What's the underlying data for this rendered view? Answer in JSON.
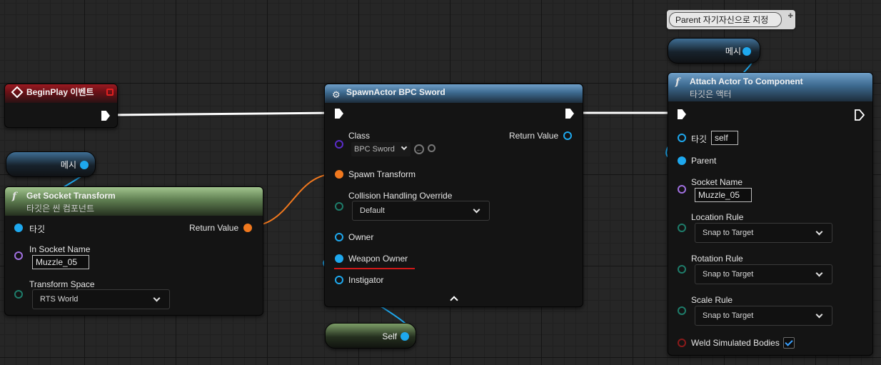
{
  "nodes": {
    "begin_play": {
      "title": "BeginPlay 이벤트"
    },
    "mesh_var_left": {
      "label": "메시"
    },
    "get_socket_transform": {
      "title": "Get Socket Transform",
      "subtitle": "타깃은 씬 컴포넌트",
      "target_label": "타깃",
      "return_label": "Return Value",
      "socket_name_label": "In Socket Name",
      "socket_name_value": "Muzzle_05",
      "transform_space_label": "Transform Space",
      "transform_space_value": "RTS World"
    },
    "spawn_actor": {
      "title": "SpawnActor BPC Sword",
      "class_label": "Class",
      "class_value": "BPC Sword",
      "return_label": "Return Value",
      "spawn_transform_label": "Spawn Transform",
      "collision_label": "Collision Handling Override",
      "collision_value": "Default",
      "owner_label": "Owner",
      "weapon_owner_label": "Weapon Owner",
      "instigator_label": "Instigator",
      "collapse_icon": "chevron-up-icon"
    },
    "self_var": {
      "label": "Self"
    },
    "comment": {
      "text": "Parent 자기자신으로 지정"
    },
    "mesh_var_right": {
      "label": "메시"
    },
    "attach_actor": {
      "title": "Attach Actor To Component",
      "subtitle": "타깃은 액터",
      "target_label": "타깃",
      "target_value": "self",
      "parent_label": "Parent",
      "socket_name_label": "Socket Name",
      "socket_name_value": "Muzzle_05",
      "location_rule_label": "Location Rule",
      "location_rule_value": "Snap to Target",
      "rotation_rule_label": "Rotation Rule",
      "rotation_rule_value": "Snap to Target",
      "scale_rule_label": "Scale Rule",
      "scale_rule_value": "Snap to Target",
      "weld_label": "Weld Simulated Bodies",
      "weld_checked": true
    }
  },
  "colors": {
    "exec_wire": "#ffffff",
    "object_wire": "#1ea8ee",
    "transform_wire": "#f0781e",
    "highlight_underline": "#d01818"
  }
}
